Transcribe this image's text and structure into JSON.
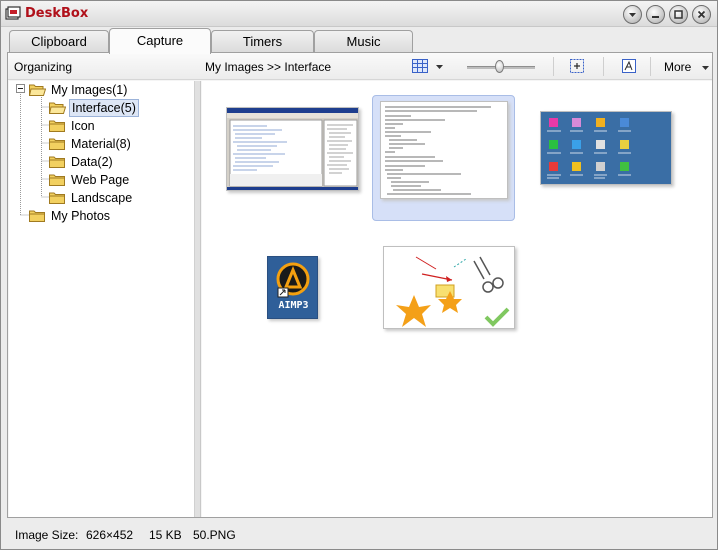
{
  "window": {
    "title": "DeskBox"
  },
  "tabs": [
    {
      "label": "Clipboard"
    },
    {
      "label": "Capture"
    },
    {
      "label": "Timers"
    },
    {
      "label": "Music"
    }
  ],
  "toolbar": {
    "organizing_label": "Organizing",
    "breadcrumb": "My Images >> Interface",
    "more_label": "More"
  },
  "tree": {
    "root": {
      "label": "My Images(1)"
    },
    "children": [
      {
        "label": "Interface(5)"
      },
      {
        "label": "Icon"
      },
      {
        "label": "Material(8)"
      },
      {
        "label": "Data(2)"
      },
      {
        "label": "Web Page"
      },
      {
        "label": "Landscape"
      }
    ],
    "second_root": {
      "label": "My Photos"
    }
  },
  "thumbnails": [
    {
      "name": "screenshot-ide"
    },
    {
      "name": "code-listing",
      "selected": true
    },
    {
      "name": "desktop-icons"
    },
    {
      "name": "aimp3-icon",
      "caption": "AIMP3"
    },
    {
      "name": "drawing-shapes"
    }
  ],
  "status": {
    "size_label": "Image Size:",
    "dimensions": "626×452",
    "filesize": "15 KB",
    "filename": "50.PNG"
  },
  "colors": {
    "title_red": "#b0101a",
    "selection_fill": "#d6e0f8",
    "folder_yellow": "#f2d060"
  }
}
